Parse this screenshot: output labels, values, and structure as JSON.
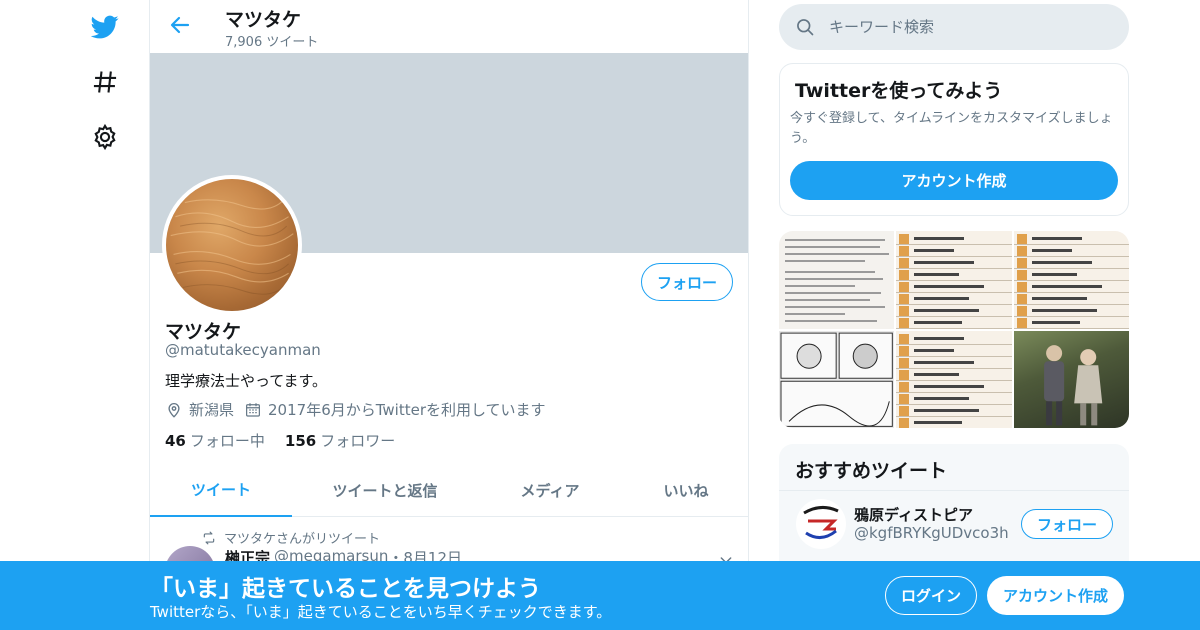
{
  "colors": {
    "accent": "#1da1f2",
    "banner": "#ccd6dd",
    "muted": "#657786",
    "text": "#14171a",
    "border": "#e6ecf0"
  },
  "nav": {
    "items": [
      {
        "icon": "twitter-bird-icon"
      },
      {
        "icon": "hashtag-icon"
      },
      {
        "icon": "gear-icon"
      }
    ]
  },
  "header": {
    "name": "マツタケ",
    "tweet_count": "7,906 ツイート",
    "back_icon": "arrow-left-icon"
  },
  "profile": {
    "name": "マツタケ",
    "handle": "@matutakecyanman",
    "bio": "理学療法士やってます。",
    "location": "新潟県",
    "joined": "2017年6月からTwitterを利用しています",
    "following_count": "46",
    "following_label": "フォロー中",
    "followers_count": "156",
    "followers_label": "フォロワー",
    "follow_button": "フォロー"
  },
  "tabs": [
    {
      "label": "ツイート",
      "active": true
    },
    {
      "label": "ツイートと返信",
      "active": false
    },
    {
      "label": "メディア",
      "active": false
    },
    {
      "label": "いいね",
      "active": false
    }
  ],
  "tweet": {
    "retweet_label": "マツタケさんがリツイート",
    "author": "榊正宗",
    "handle": "@megamarsun",
    "date": "・8月12日"
  },
  "search": {
    "placeholder": "キーワード検索"
  },
  "signup_card": {
    "title": "Twitterを使ってみよう",
    "description": "今すぐ登録して、タイムラインをカスタマイズしましょう。",
    "button": "アカウント作成"
  },
  "recommend": {
    "title": "おすすめツイート",
    "name": "鴉原ディストピア",
    "handle": "@kgfBRYKgUDvco3h",
    "follow_button": "フォロー"
  },
  "bottom_bar": {
    "title": "「いま」起きていることを見つけよう",
    "subtitle": "Twitterなら、「いま」起きていることをいち早くチェックできます。",
    "login": "ログイン",
    "signup": "アカウント作成"
  }
}
